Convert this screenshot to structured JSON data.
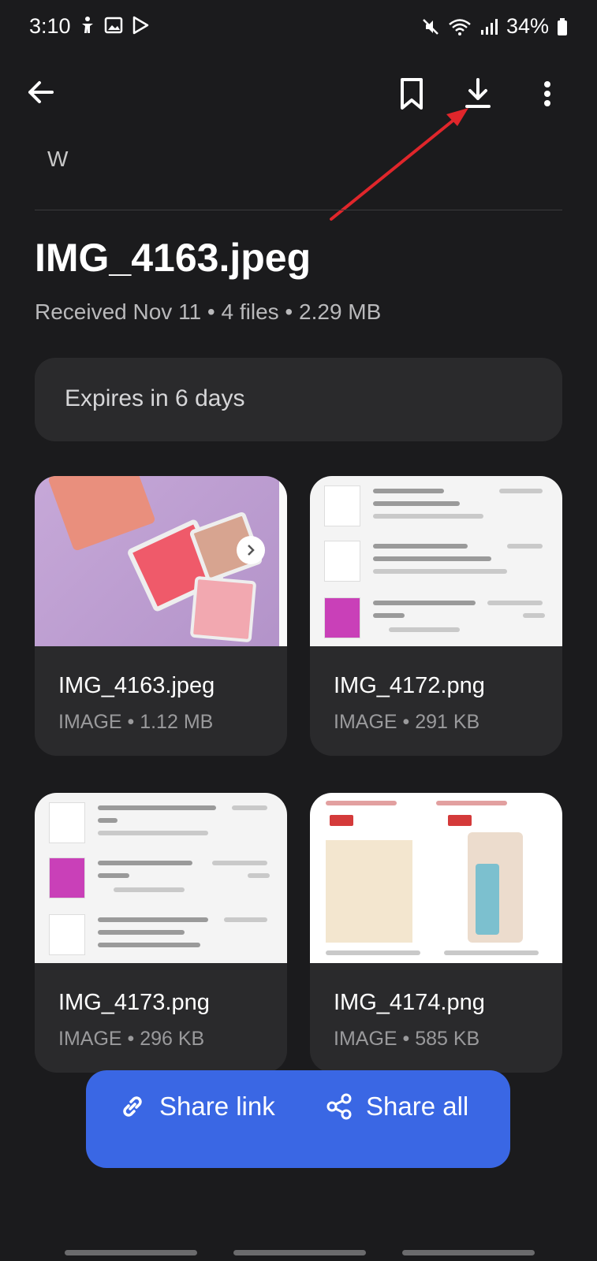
{
  "status_bar": {
    "time": "3:10",
    "battery": "34%"
  },
  "header": {
    "sender": "W",
    "title": "IMG_4163.jpeg",
    "meta": "Received Nov 11 • 4 files • 2.29 MB",
    "expiry": "Expires in 6 days"
  },
  "files": [
    {
      "name": "IMG_4163.jpeg",
      "info": "IMAGE • 1.12 MB"
    },
    {
      "name": "IMG_4172.png",
      "info": "IMAGE • 291 KB"
    },
    {
      "name": "IMG_4173.png",
      "info": "IMAGE • 296 KB"
    },
    {
      "name": "IMG_4174.png",
      "info": "IMAGE • 585 KB"
    }
  ],
  "actions": {
    "share_link": "Share link",
    "share_all": "Share all"
  },
  "colors": {
    "background": "#1b1b1d",
    "card": "#2a2a2c",
    "accent": "#3a67e4",
    "annotation": "#e0262b"
  },
  "icons": [
    "back-arrow-icon",
    "bookmark-icon",
    "download-icon",
    "more-vert-icon",
    "link-icon",
    "share-icon"
  ]
}
